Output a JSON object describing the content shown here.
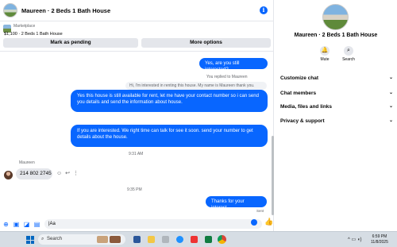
{
  "header": {
    "title": "Maureen · 2 Beds 1 Bath House",
    "info_icon": "info-icon"
  },
  "marketplace": {
    "label": "Marketplace",
    "listing": "$1,100 · 2 Beds 1 Bath House",
    "mark_pending_label": "Mark as pending",
    "more_options_label": "More options"
  },
  "messages": {
    "m1": "Yes, are you still interested?",
    "replied_label": "You replied to Maureen",
    "quoted": "Hi, I'm interested in renting this house. My name is Maureen thank you.",
    "m2": "Yes this house is still available for rent, let me have your contact number so i can send you details and send the information about house.",
    "m3": "If you are interested. We right time can talk for see it soon. send your number to get details about the house.",
    "time1": "9:31 AM",
    "sender": "Maureen",
    "incoming": "214 802 2745",
    "time2": "9:35 PM",
    "m4": "Thanks for your interest.",
    "status": "Sent"
  },
  "composer": {
    "value": "|Aa"
  },
  "sidebar": {
    "title": "Maureen · 2 Beds 1 Bath House",
    "mute_label": "Mute",
    "search_label": "Search",
    "items": [
      {
        "label": "Customize chat"
      },
      {
        "label": "Chat members"
      },
      {
        "label": "Media, files and links"
      },
      {
        "label": "Privacy & support"
      }
    ]
  },
  "taskbar": {
    "search_placeholder": "Search",
    "time": "6:59 PM",
    "date": "11/8/2025"
  },
  "colors": {
    "accent": "#0866ff",
    "bubble_incoming": "#e4e6eb",
    "taskbar": "#d6dde4"
  }
}
